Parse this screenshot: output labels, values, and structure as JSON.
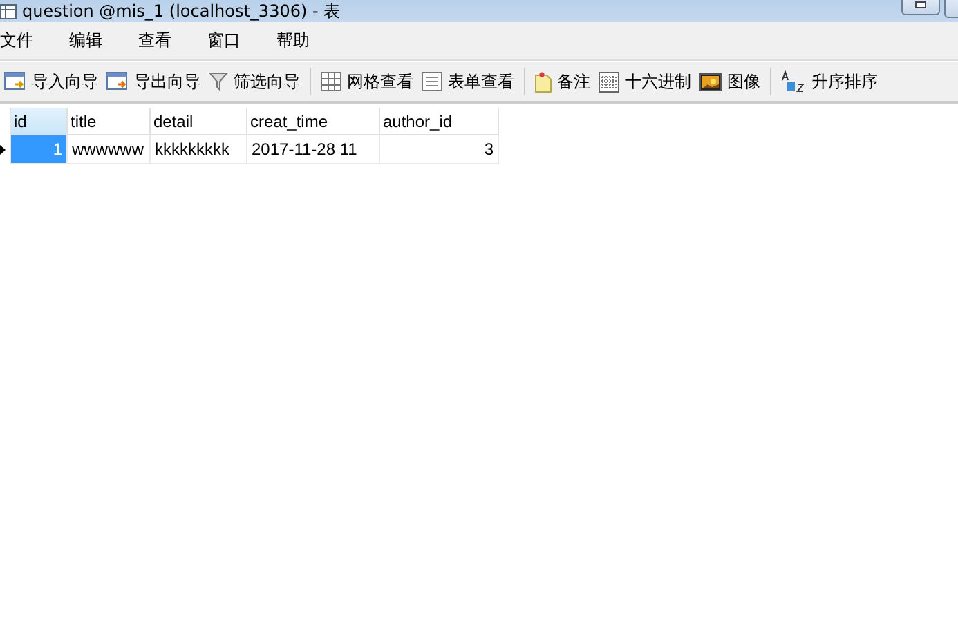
{
  "window": {
    "title": "question @mis_1 (localhost_3306) - 表"
  },
  "menu": [
    "文件",
    "编辑",
    "查看",
    "窗口",
    "帮助"
  ],
  "toolbar": [
    [
      {
        "label": "导入向导",
        "kind": "import"
      },
      {
        "label": "导出向导",
        "kind": "export"
      },
      {
        "label": "筛选向导",
        "kind": "filter"
      }
    ],
    [
      {
        "label": "网格查看",
        "kind": "grid"
      },
      {
        "label": "表单查看",
        "kind": "form"
      }
    ],
    [
      {
        "label": "备注",
        "kind": "memo"
      },
      {
        "label": "十六进制",
        "kind": "hex"
      },
      {
        "label": "图像",
        "kind": "image"
      }
    ],
    [
      {
        "label": "升序排序",
        "kind": "sort"
      }
    ]
  ],
  "table": {
    "columns": [
      {
        "name": "id",
        "selected": true,
        "numeric": true
      },
      {
        "name": "title",
        "selected": false,
        "numeric": false
      },
      {
        "name": "detail",
        "selected": false,
        "numeric": false
      },
      {
        "name": "creat_time",
        "selected": false,
        "numeric": false
      },
      {
        "name": "author_id",
        "selected": false,
        "numeric": true
      }
    ],
    "rows": [
      {
        "current": true,
        "cells": [
          {
            "text": "1",
            "selected": true
          },
          {
            "text": "wwwwww",
            "selected": false
          },
          {
            "text": "kkkkkkkkk",
            "selected": false
          },
          {
            "text": "2017-11-28 11",
            "selected": false
          },
          {
            "text": "3",
            "selected": false
          }
        ]
      }
    ]
  }
}
